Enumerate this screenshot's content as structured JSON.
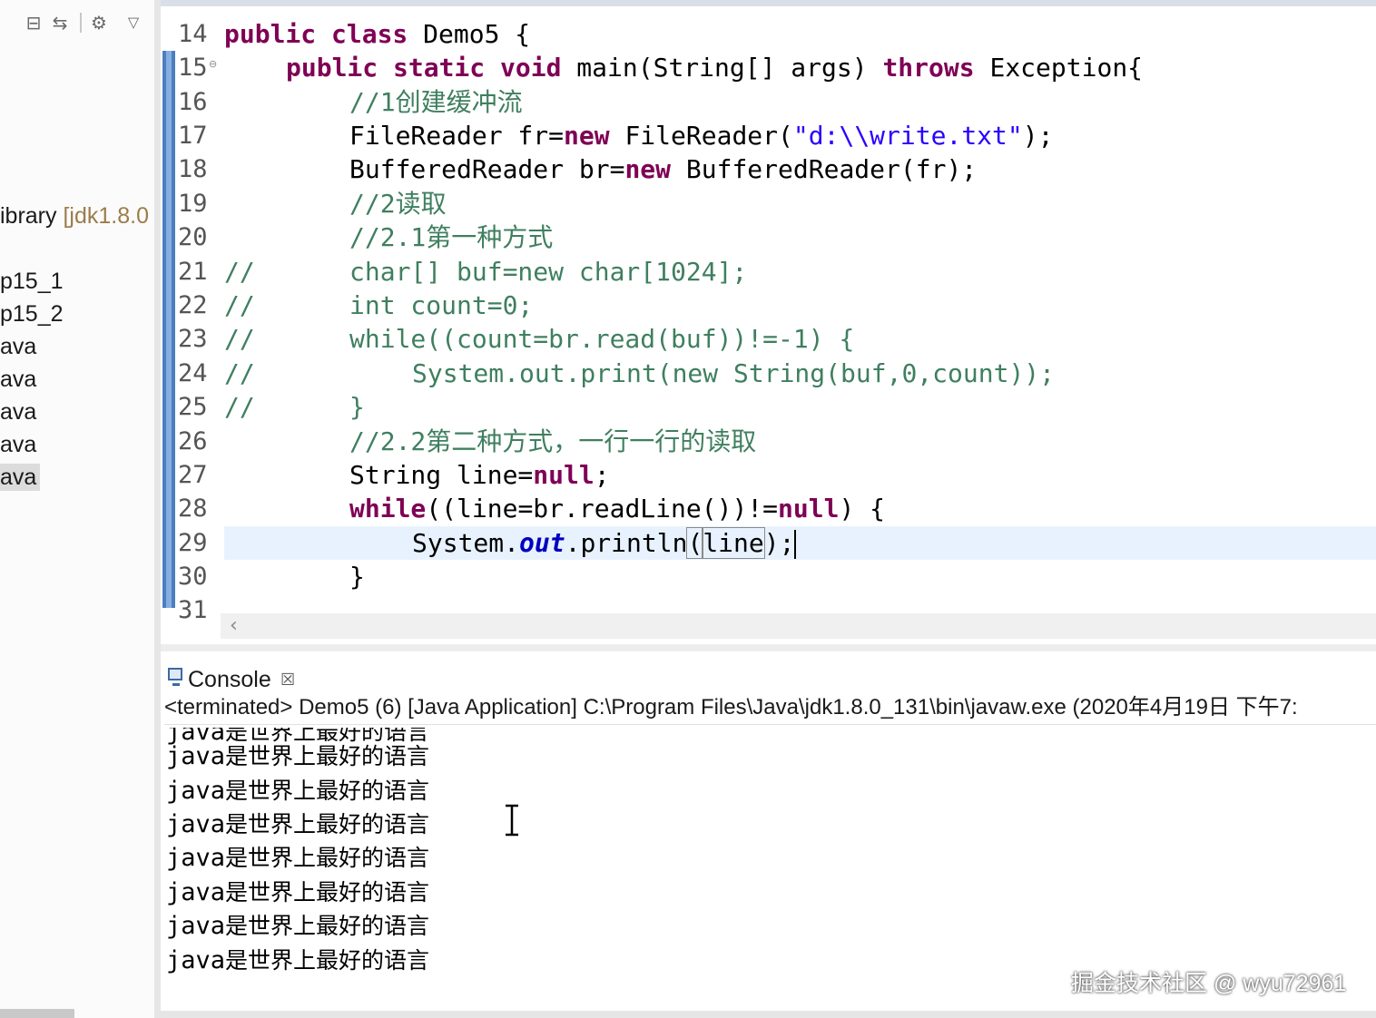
{
  "sidebar": {
    "toolbar": {
      "collapse_icon": "collapse-all-icon",
      "link_icon": "link-with-editor-icon",
      "filter_icon": "filter-icon",
      "menu_icon": "view-menu-icon"
    },
    "items": [
      {
        "label": "ibrary ",
        "suffix": "[jdk1.8.0"
      },
      {
        "label": "p15_1"
      },
      {
        "label": "p15_2"
      },
      {
        "label": "ava"
      },
      {
        "label": "ava"
      },
      {
        "label": "ava"
      },
      {
        "label": "ava"
      },
      {
        "label": "ava",
        "selected": true
      }
    ]
  },
  "editor": {
    "line_numbers": [
      "14",
      "15",
      "16",
      "17",
      "18",
      "19",
      "20",
      "21",
      "22",
      "23",
      "24",
      "25",
      "26",
      "27",
      "28",
      "29",
      "30",
      "31"
    ],
    "lines": {
      "l14_kw": "public class",
      "l14_rest": " Demo5 {",
      "l15_kw1": "public static void",
      "l15_mid": " main(String[] args) ",
      "l15_kw2": "throws",
      "l15_rest": " Exception{",
      "l16": "//1创建缓冲流",
      "l17_a": "FileReader fr=",
      "l17_kw": "new",
      "l17_b": " FileReader(",
      "l17_str": "\"d:\\\\write.txt\"",
      "l17_c": ");",
      "l18_a": "BufferedReader br=",
      "l18_kw": "new",
      "l18_b": " BufferedReader(fr);",
      "l19": "//2读取",
      "l20": "//2.1第一种方式",
      "l21_prefix": "//",
      "l21": "char[] buf=new char[1024];",
      "l22_prefix": "//",
      "l22": "int count=0;",
      "l23_prefix": "//",
      "l23": "while((count=br.read(buf))!=-1) {",
      "l24_prefix": "//",
      "l24": "System.out.print(new String(buf,0,count));",
      "l25_prefix": "//",
      "l25": "}",
      "l26": "//2.2第二种方式，一行一行的读取",
      "l27_a": "String line=",
      "l27_kw": "null",
      "l27_b": ";",
      "l28_kw1": "while",
      "l28_a": "((line=br.readLine())!=",
      "l28_kw2": "null",
      "l28_b": ") {",
      "l29_a": "System.",
      "l29_field": "out",
      "l29_b": ".println",
      "l29_paren": "(",
      "l29_arg": "line",
      "l29_c": ");",
      "l30": "}"
    }
  },
  "console": {
    "tab_label": "Console",
    "close_glyph": "☒",
    "header": "<terminated> Demo5 (6) [Java Application] C:\\Program Files\\Java\\jdk1.8.0_131\\bin\\javaw.exe (2020年4月19日 下午7:",
    "output": [
      {
        "a": "java",
        "b": "是世界上最好的语言"
      },
      {
        "a": "java",
        "b": "是世界上最好的语言"
      },
      {
        "a": "java",
        "b": "是世界上最好的语言"
      },
      {
        "a": "java",
        "b": "是世界上最好的语言"
      },
      {
        "a": "java",
        "b": "是世界上最好的语言"
      },
      {
        "a": "java",
        "b": "是世界上最好的语言"
      },
      {
        "a": "java",
        "b": "是世界上最好的语言"
      },
      {
        "a": "java",
        "b": "是世界上最好的语言"
      }
    ]
  },
  "watermark": "掘金技术社区 @ wyu72961",
  "colors": {
    "keyword": "#7f0055",
    "comment": "#3f7f5f",
    "string": "#2a00ff",
    "field": "#0000c0",
    "current_line": "#e8f2fe"
  }
}
